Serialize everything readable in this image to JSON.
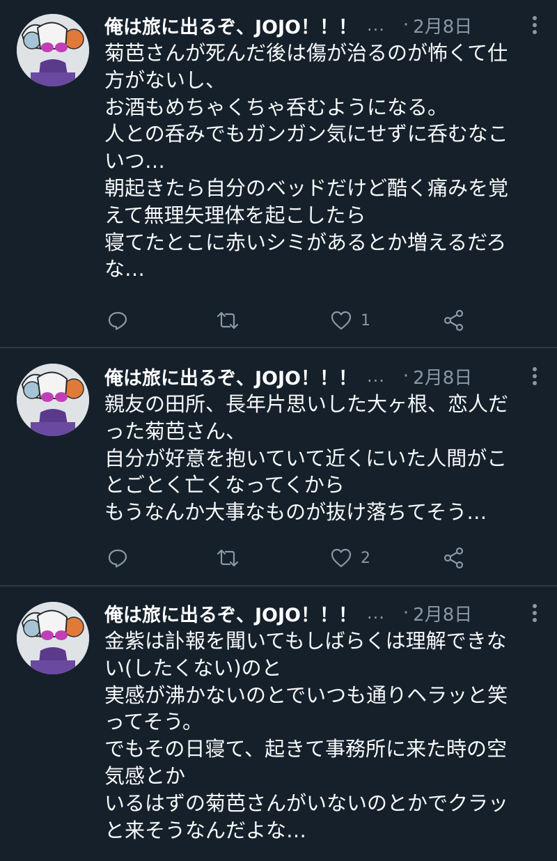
{
  "tweets": [
    {
      "author": "俺は旅に出るぞ、JOJO！！！",
      "ellipsis": "...",
      "date": "2月8日",
      "dot": "·",
      "lines": [
        "菊芭さんが死んだ後は傷が治るのが怖くて仕",
        "方がないし、",
        "お酒もめちゃくちゃ呑むようになる。",
        "人との呑みでもガンガン気にせずに呑むなこ",
        "いつ…",
        "朝起きたら自分のベッドだけど酷く痛みを覚",
        "えて無理矢理体を起こしたら",
        "寝てたとこに赤いシミがあるとか増えるだろ",
        "な…"
      ],
      "like_count": "1"
    },
    {
      "author": "俺は旅に出るぞ、JOJO！！！",
      "ellipsis": "...",
      "date": "2月8日",
      "dot": "·",
      "lines": [
        "親友の田所、長年片思いした大ヶ根、恋人だ",
        "った菊芭さん、",
        "自分が好意を抱いていて近くにいた人間がこ",
        "とごとく亡くなってくから",
        "もうなんか大事なものが抜け落ちてそう…"
      ],
      "like_count": "2"
    },
    {
      "author": "俺は旅に出るぞ、JOJO！！！",
      "ellipsis": "...",
      "date": "2月8日",
      "dot": "·",
      "lines": [
        "金紫は訃報を聞いてもしばらくは理解できな",
        "い(したくない)のと",
        "実感が沸かないのとでいつも通りヘラッと笑",
        "ってそう。",
        "でもその日寝て、起きて事務所に来た時の空",
        "気感とか",
        "いるはずの菊芭さんがいないのとかでクラッ",
        "と来そうなんだよな…"
      ]
    }
  ],
  "colors": {
    "background": "#15202b",
    "divider": "#2f3b47",
    "muted": "#8b98a5",
    "text": "#f7f9f9"
  },
  "icons": {
    "reply": "reply-icon",
    "retweet": "retweet-icon",
    "like": "heart-icon",
    "share": "share-icon",
    "more": "more-vertical-icon"
  }
}
